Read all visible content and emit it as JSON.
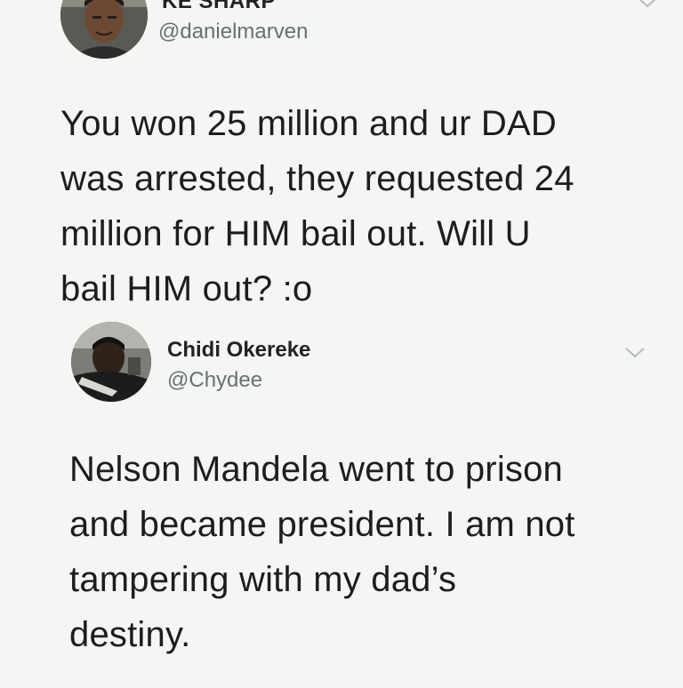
{
  "tweets": [
    {
      "name": "KE SHARP",
      "handle": "@danielmarven",
      "avatar_icon": "profile-photo-icon",
      "menu_icon": "chevron-down-icon",
      "lines": [
        "You won 25 million and ur DAD",
        "was arrested, they requested 24",
        "million for HIM bail out. Will U",
        "bail HIM out? :o"
      ]
    },
    {
      "name": "Chidi Okereke",
      "handle": "@Chydee",
      "avatar_icon": "profile-photo-icon",
      "menu_icon": "chevron-down-icon",
      "lines": [
        "Nelson Mandela went to prison",
        "and became president. I am not",
        "tampering with my dad’s",
        "destiny."
      ]
    }
  ],
  "colors": {
    "background": "#f4f6f3",
    "text": "#1d1d1d",
    "handle": "#6b6f72",
    "chevron": "#b8bbbd"
  }
}
